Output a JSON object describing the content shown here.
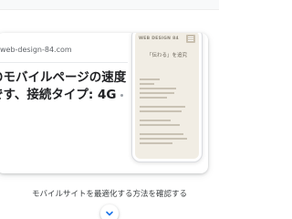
{
  "result": {
    "site_url": "web-design-84.com",
    "headline_line1": "のモバイルページの速度",
    "headline_line2": "です、接続タイプ: 4G"
  },
  "mobile_preview": {
    "logo": "WEB DESIGN 84",
    "tagline": "「伝わる」を追究"
  },
  "cta": {
    "label": "モバイルサイトを最適化する方法を確認する"
  },
  "icons": {
    "expand": "chevron-down-icon",
    "menu": "hamburger-menu-icon"
  },
  "colors": {
    "accent": "#1a73e8",
    "text_primary": "#202124",
    "text_secondary": "#5f6368",
    "preview_bg": "#f1ede4"
  }
}
